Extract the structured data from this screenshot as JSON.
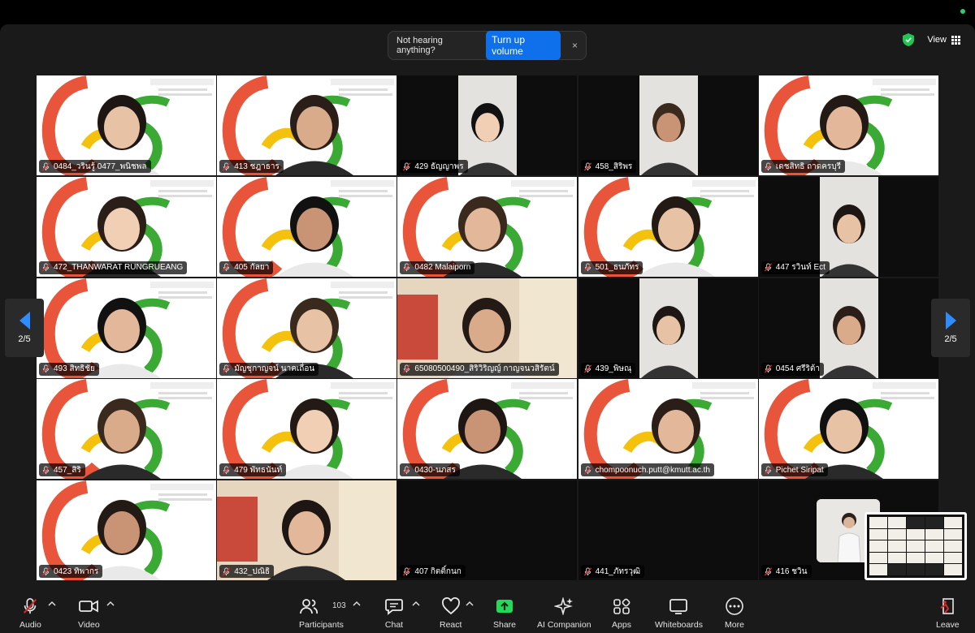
{
  "banner": {
    "message": "Not hearing anything?",
    "button": "Turn up volume",
    "close": "×"
  },
  "header": {
    "view_label": "View"
  },
  "pager": {
    "left": "2/5",
    "right": "2/5"
  },
  "participants": [
    [
      "0484_วรินรู้ 0477_พนิชพล",
      "413 ชฎาธาร",
      "429 ธัญญาพร",
      "458_สิริพร",
      "เดชสิทธิ ถาดครบุรี"
    ],
    [
      "472_THANWARAT RUNGRUEANG",
      "405 กัลยา",
      "0482 Malaiporn",
      "501_ธนภัทร",
      "447 รวินท์ Ect"
    ],
    [
      "493 สิทธิชัย",
      "มัญชุกาญจน์ นาคเถื่อน",
      "65080500490_สิริวิริญญ์ กาญจนวสิรัตน์",
      "439_พิษณุ",
      "0454 ศรีริต้า"
    ],
    [
      "457_สิริ",
      "479 พัทธนันท์",
      "0430-นภสร",
      "chompoonuch.putt@kmutt.ac.th",
      "Pichet Siripat"
    ],
    [
      "0423 ทิพากร",
      "432_ปณิธิ",
      "407 กิตติ์กนก",
      "441_ภัทรวุฒิ",
      "416 ชวิน"
    ]
  ],
  "toolbar": {
    "audio": "Audio",
    "video": "Video",
    "participants": "Participants",
    "participant_count": "103",
    "chat": "Chat",
    "react": "React",
    "share": "Share",
    "ai": "AI Companion",
    "apps": "Apps",
    "whiteboards": "Whiteboards",
    "more": "More",
    "leave": "Leave"
  },
  "colors": {
    "accent": "#0e71eb",
    "share": "#23d959",
    "muted": "#e02828",
    "logo_red": "#e8553a",
    "logo_yellow": "#f4c20d",
    "logo_green": "#3aaa35"
  }
}
